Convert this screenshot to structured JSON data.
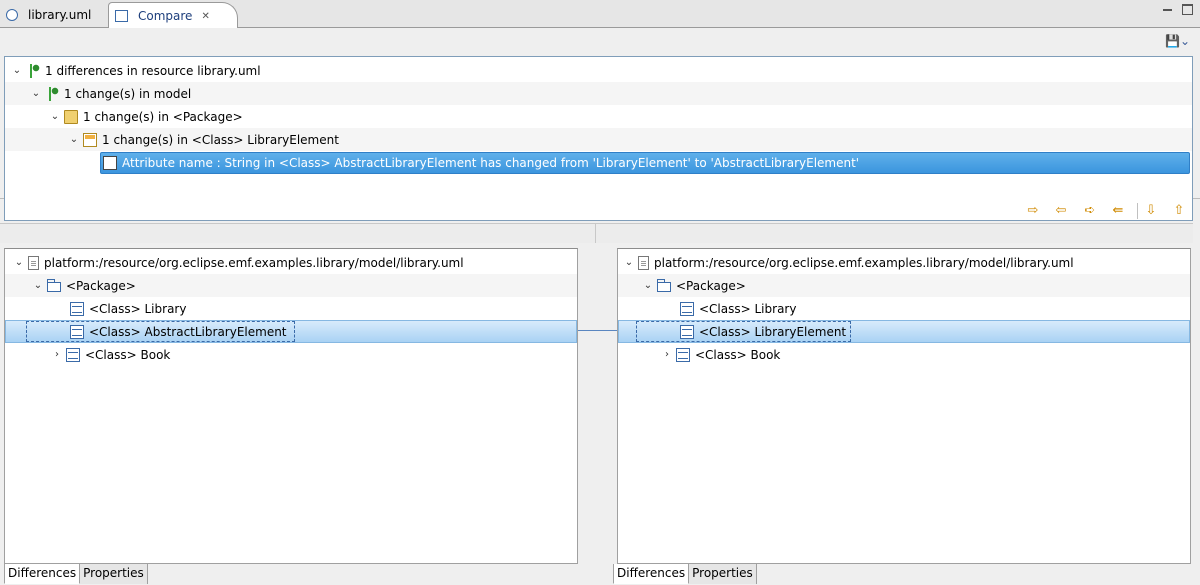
{
  "tabs": {
    "library": "library.uml",
    "compare": "Compare"
  },
  "structure": {
    "rows": [
      "1 differences in resource library.uml",
      "1 change(s) in model",
      "1 change(s) in <Package>",
      "1 change(s) in <Class> LibraryElement",
      "Attribute name : String in <Class> AbstractLibraryElement has changed from 'LibraryElement' to 'AbstractLibraryElement'"
    ],
    "attr_icon_text": "ab"
  },
  "left": {
    "resource": "platform:/resource/org.eclipse.emf.examples.library/model/library.uml",
    "package": "<Package>",
    "classes": [
      "<Class> Library",
      "<Class> AbstractLibraryElement",
      "<Class> Book"
    ]
  },
  "right": {
    "resource": "platform:/resource/org.eclipse.emf.examples.library/model/library.uml",
    "package": "<Package>",
    "classes": [
      "<Class> Library",
      "<Class> LibraryElement",
      "<Class> Book"
    ]
  },
  "viewtabs": {
    "differences": "Differences",
    "properties": "Properties"
  },
  "icons": {
    "expanded": "chevron-down-icon",
    "collapsed": "chevron-right-icon"
  }
}
